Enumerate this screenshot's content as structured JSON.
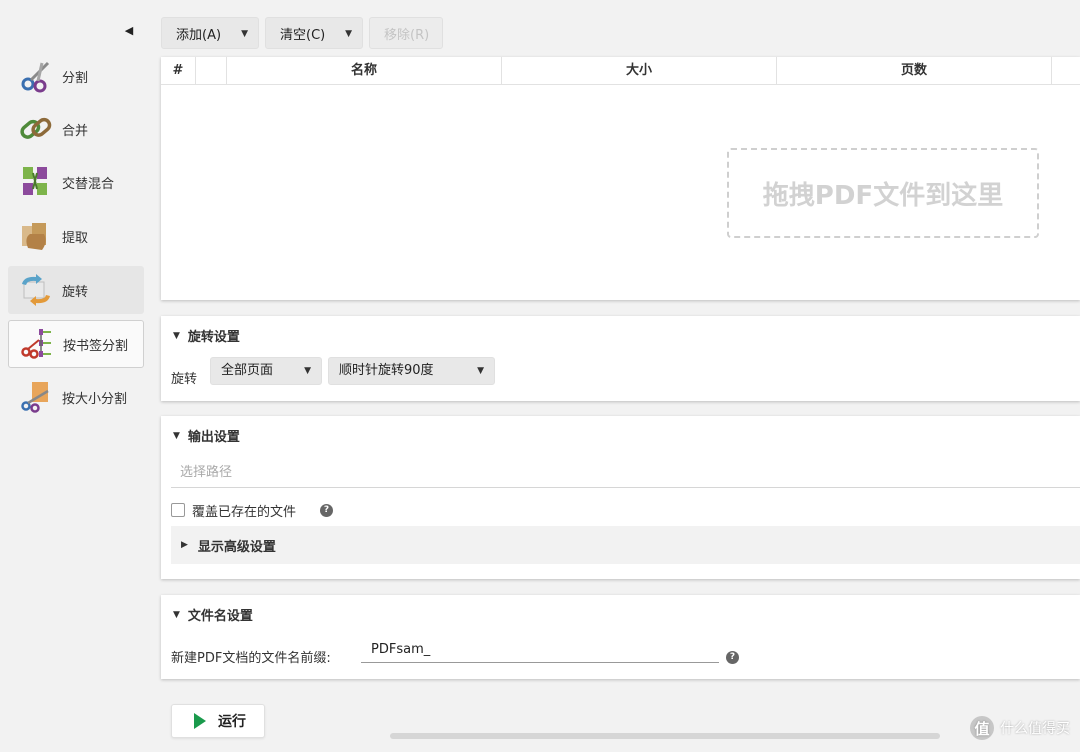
{
  "sidebar": {
    "collapse_icon": "triangle-left-icon",
    "items": [
      {
        "label": "分割",
        "icon": "scissors-icon"
      },
      {
        "label": "合并",
        "icon": "chain-link-icon"
      },
      {
        "label": "交替混合",
        "icon": "alternate-mix-icon"
      },
      {
        "label": "提取",
        "icon": "extract-hand-icon"
      },
      {
        "label": "旋转",
        "icon": "rotate-arrows-icon"
      },
      {
        "label": "按书签分割",
        "icon": "bookmark-split-icon"
      },
      {
        "label": "按大小分割",
        "icon": "size-split-icon"
      }
    ],
    "active_index": 4
  },
  "toolbar": {
    "add_label": "添加(A)",
    "clear_label": "清空(C)",
    "remove_label": "移除(R)"
  },
  "file_table": {
    "columns": [
      "#",
      "",
      "名称",
      "大小",
      "页数"
    ],
    "drop_hint": "拖拽PDF文件到这里"
  },
  "rotate_settings": {
    "title": "旋转设置",
    "rotate_label": "旋转",
    "pages_value": "全部页面",
    "direction_value": "顺时针旋转90度"
  },
  "output_settings": {
    "title": "输出设置",
    "path_placeholder": "选择路径",
    "overwrite_label": "覆盖已存在的文件",
    "overwrite_checked": false,
    "advanced_label": "显示高级设置"
  },
  "filename_settings": {
    "title": "文件名设置",
    "prefix_label": "新建PDF文档的文件名前缀:",
    "prefix_value": "PDFsam_"
  },
  "run_label": "运行",
  "watermark": {
    "badge": "值",
    "text": "什么值得买"
  },
  "colors": {
    "accent_green": "#1a9a4c",
    "panel_bg": "#ffffff",
    "app_bg": "#f2f2f2"
  }
}
